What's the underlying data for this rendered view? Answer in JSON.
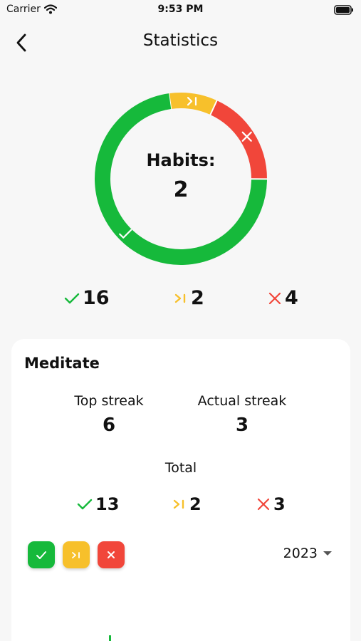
{
  "colors": {
    "done": "#16b93b",
    "skipped": "#f7c02b",
    "failed": "#f1463a",
    "background": "#f7f7f7",
    "card": "#ffffff"
  },
  "status_bar": {
    "carrier": "Carrier",
    "time": "9:53 PM",
    "icons": [
      "wifi-icon",
      "battery-icon"
    ]
  },
  "header": {
    "title": "Statistics",
    "back_icon": "chevron-left-icon"
  },
  "donut": {
    "label": "Habits:",
    "value": "2",
    "segments": [
      {
        "name": "done",
        "value": 16,
        "icon": "check-icon"
      },
      {
        "name": "skipped",
        "value": 2,
        "icon": "skip-icon"
      },
      {
        "name": "failed",
        "value": 4,
        "icon": "close-icon"
      }
    ]
  },
  "summary": {
    "done": "16",
    "skipped": "2",
    "failed": "4"
  },
  "habit": {
    "name": "Meditate",
    "top_streak_label": "Top streak",
    "top_streak_value": "6",
    "actual_streak_label": "Actual streak",
    "actual_streak_value": "3",
    "total_label": "Total",
    "totals": {
      "done": "13",
      "skipped": "2",
      "failed": "3"
    },
    "year": "2023"
  }
}
